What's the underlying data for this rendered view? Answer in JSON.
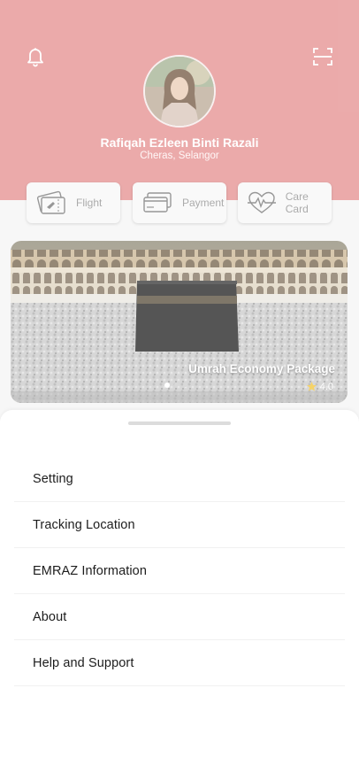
{
  "profile": {
    "name": "Rafiqah Ezleen Binti Razali",
    "location": "Cheras, Selangor"
  },
  "header_icons": {
    "left": "bell-icon",
    "right": "scan-icon"
  },
  "quick_actions": [
    {
      "label": "Flight",
      "icon": "flight-ticket-icon"
    },
    {
      "label": "Payment",
      "icon": "credit-card-icon"
    },
    {
      "label": "Care Card",
      "icon": "heart-pulse-icon"
    }
  ],
  "banner": {
    "title": "Umrah Economy Package",
    "rating": "4.0",
    "pages": 3,
    "active_page": 1
  },
  "menu": [
    {
      "label": "Setting"
    },
    {
      "label": "Tracking Location"
    },
    {
      "label": "EMRAZ Information"
    },
    {
      "label": "About"
    },
    {
      "label": "Help and Support"
    }
  ],
  "colors": {
    "header": "#e38a8a",
    "star": "#f2c230"
  }
}
